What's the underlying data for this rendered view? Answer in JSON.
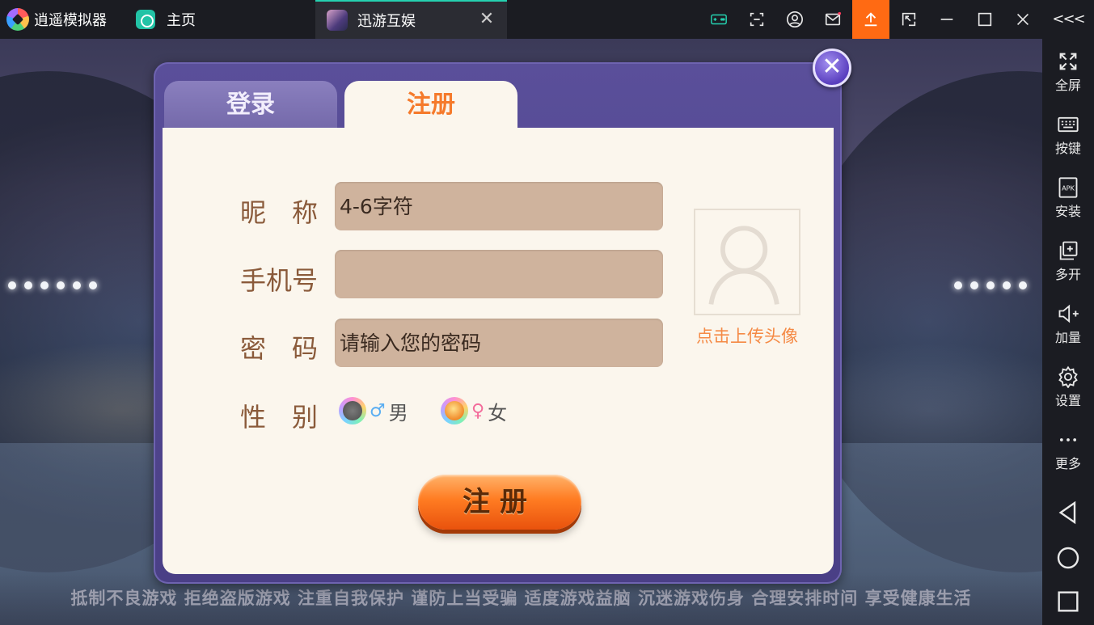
{
  "app": {
    "name": "逍遥模拟器",
    "home_tab": "主页",
    "game_tab": "迅游互娱",
    "accent": "#25d1b0",
    "upload_color": "#ff6a13"
  },
  "window_controls": [
    "gamepad-icon",
    "screenshot-icon",
    "user-icon",
    "mail-icon",
    "upload-icon",
    "scale-icon",
    "minimize-icon",
    "maximize-icon",
    "close-icon"
  ],
  "sidebar": {
    "collapse": "<<<",
    "items": [
      {
        "label": "全屏",
        "icon": "fullscreen-icon"
      },
      {
        "label": "按键",
        "icon": "keyboard-icon"
      },
      {
        "label": "安装",
        "icon": "apk-icon"
      },
      {
        "label": "多开",
        "icon": "multi-open-icon"
      },
      {
        "label": "加量",
        "icon": "volume-up-icon"
      },
      {
        "label": "设置",
        "icon": "gear-icon"
      },
      {
        "label": "更多",
        "icon": "more-icon"
      }
    ],
    "nav": [
      "back-icon",
      "home-circle-icon",
      "recent-square-icon"
    ]
  },
  "dialog": {
    "tabs": {
      "login": "登录",
      "register": "注册"
    },
    "active_tab": "register",
    "fields": {
      "nickname": {
        "label": "昵　称",
        "placeholder": "4-6字符",
        "value": ""
      },
      "phone": {
        "label": "手机号",
        "placeholder": "",
        "value": ""
      },
      "password": {
        "label": "密　码",
        "placeholder": "请输入您的密码",
        "value": ""
      }
    },
    "gender": {
      "label": "性　别",
      "male": {
        "symbol": "♂",
        "text": "男",
        "selected": false
      },
      "female": {
        "symbol": "♀",
        "text": "女",
        "selected": true
      }
    },
    "avatar_label": "点击上传头像",
    "submit": "注册"
  },
  "notice": "抵制不良游戏 拒绝盗版游戏 注重自我保护 谨防上当受骗 适度游戏益脑 沉迷游戏伤身 合理安排时间 享受健康生活"
}
